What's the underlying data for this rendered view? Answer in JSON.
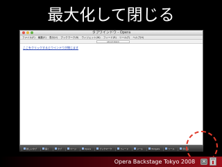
{
  "slide": {
    "title": "最大化して閉じる"
  },
  "window": {
    "title": "タブワインドウ - Opera",
    "menu": [
      "ファイル(F)",
      "編集(E)",
      "表示(V)",
      "ブックマーク(B)",
      "ウィジェット(W)",
      "フィード(R)",
      "ツール(T)",
      "ヘルプ(H)"
    ],
    "address": "about:blank",
    "content_link": "ここをクリックするとウインドウが閉じます"
  },
  "taskbar": {
    "items": [
      "新しいタブ",
      "開く",
      "タブ",
      "ページ",
      "Opera",
      "ブックマーク",
      "フィード",
      "メール",
      "Widgets",
      "ツール",
      "閉じる"
    ]
  },
  "footer": {
    "text": "Opera Backstage Tokyo 2008",
    "close_glyph": "×"
  },
  "colors": {
    "accent": "#a0101c",
    "circle": "#e03a2a"
  }
}
